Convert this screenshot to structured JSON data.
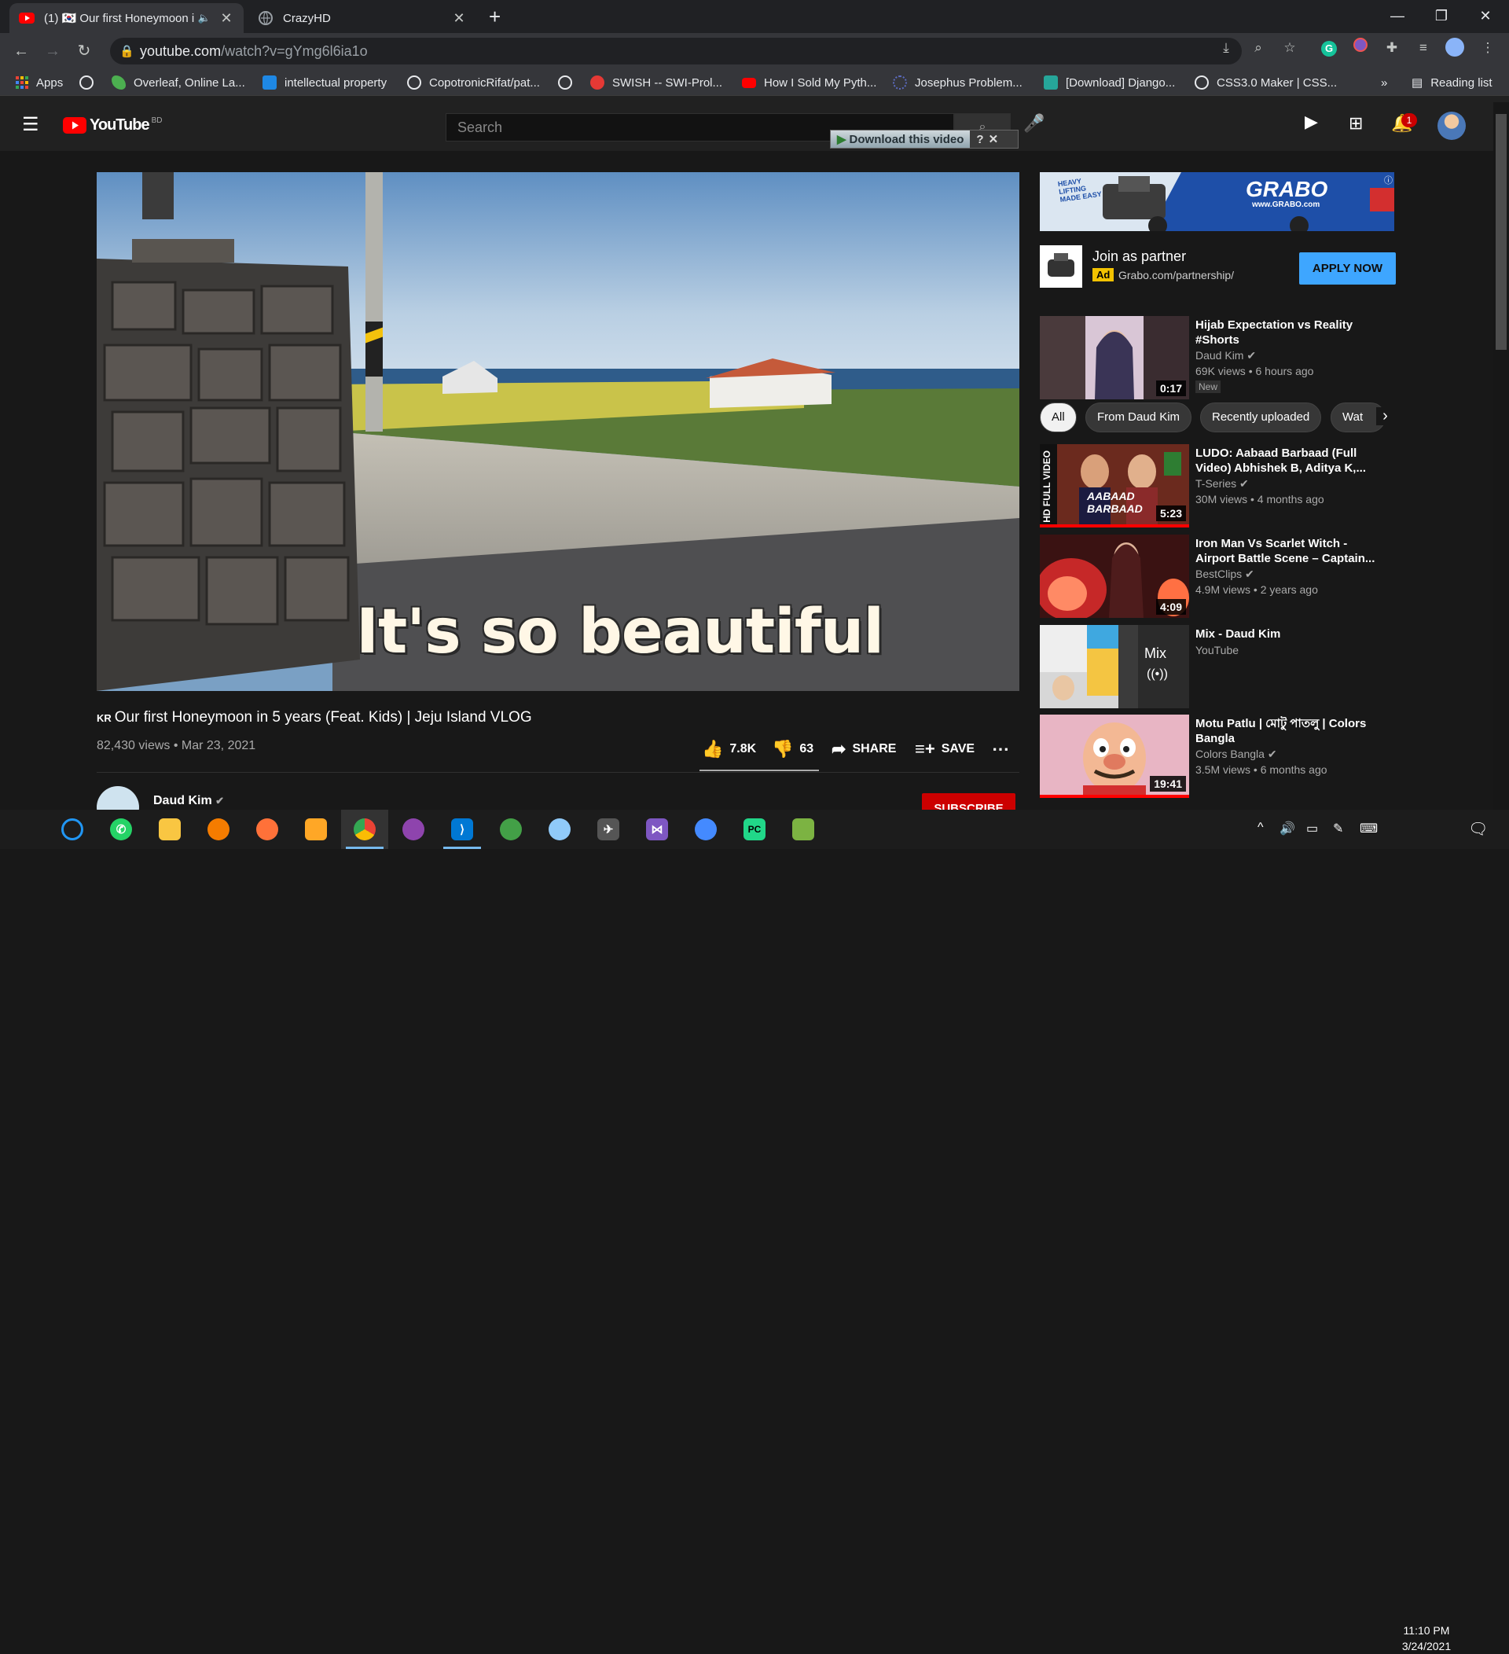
{
  "browser": {
    "tabs": [
      {
        "title": "(1) 🇰🇷 Our first Honeymoon i",
        "active": true
      },
      {
        "title": "CrazyHD",
        "active": false
      }
    ],
    "new_tab": "+",
    "url_host": "youtube.com",
    "url_path": "/watch?v=gYmg6l6ia1o",
    "window_controls": {
      "minimize": "—",
      "restore": "❐",
      "close": "✕"
    }
  },
  "bookmarks": [
    {
      "label": "Apps",
      "color": "#ea4335"
    },
    {
      "label": "",
      "color": "#e8eaed"
    },
    {
      "label": "Overleaf, Online La...",
      "color": "#4caf50"
    },
    {
      "label": "intellectual property",
      "color": "#1e88e5"
    },
    {
      "label": "CopotronicRifat/pat...",
      "color": "#e8eaed"
    },
    {
      "label": "",
      "color": "#e8eaed"
    },
    {
      "label": "SWISH -- SWI-Prol...",
      "color": "#e53935"
    },
    {
      "label": "How I Sold My Pyth...",
      "color": "#ff0000"
    },
    {
      "label": "Josephus Problem...",
      "color": "#5c6bc0"
    },
    {
      "label": "[Download] Django...",
      "color": "#26a69a"
    },
    {
      "label": "CSS3.0 Maker | CSS...",
      "color": "#e8eaed"
    }
  ],
  "bookmarks_more": "»",
  "reading_list": "Reading list",
  "youtube": {
    "logo_text": "YouTube",
    "logo_region": "BD",
    "search_placeholder": "Search",
    "download_banner": "Download this video",
    "notification_count": "1"
  },
  "video": {
    "caption": "It's so beautiful",
    "title": "🇰🇷 Our first Honeymoon in 5 years (Feat. Kids) | Jeju Island VLOG",
    "title_flag": "KR",
    "title_text": "Our first Honeymoon in 5 years (Feat. Kids) | Jeju Island VLOG",
    "views_date": "82,430 views • Mar 23, 2021",
    "likes": "7.8K",
    "dislikes": "63",
    "share": "SHARE",
    "save": "SAVE",
    "channel": "Daud Kim",
    "subscribe": "SUBSCRIBE"
  },
  "ad": {
    "banner_brand": "GRABO",
    "banner_url": "www.GRABO.com",
    "banner_tagline": "HEAVY LIFTING MADE EASY",
    "title": "Join as partner",
    "badge": "Ad",
    "url": "Grabo.com/partnership/",
    "cta": "APPLY NOW"
  },
  "chips": [
    "All",
    "From Daud Kim",
    "Recently uploaded",
    "Wat"
  ],
  "recommendations": [
    {
      "title": "Hijab Expectation vs Reality #Shorts",
      "channel": "Daud Kim",
      "meta": "69K views • 6 hours ago",
      "badge": "New",
      "duration": "0:17",
      "progress": 0
    },
    {
      "title": "LUDO: Aabaad Barbaad (Full Video) Abhishek B, Aditya K,...",
      "channel": "T-Series",
      "meta": "30M views • 4 months ago",
      "duration": "5:23",
      "progress": 1.0
    },
    {
      "title": "Iron Man Vs Scarlet Witch - Airport Battle Scene – Captain...",
      "channel": "BestClips",
      "meta": "4.9M views • 2 years ago",
      "duration": "4:09",
      "progress": 0
    },
    {
      "title": "Mix - Daud Kim",
      "channel": "YouTube",
      "meta": "",
      "duration": "",
      "mix_label": "Mix",
      "progress": 0
    },
    {
      "title": "Motu Patlu | মোটু পাতলু | Colors Bangla",
      "channel": "Colors Bangla",
      "meta": "3.5M views • 6 months ago",
      "duration": "19:41",
      "progress": 1.0
    }
  ],
  "taskbar": {
    "time": "11:10 PM",
    "date": "3/24/2021"
  }
}
